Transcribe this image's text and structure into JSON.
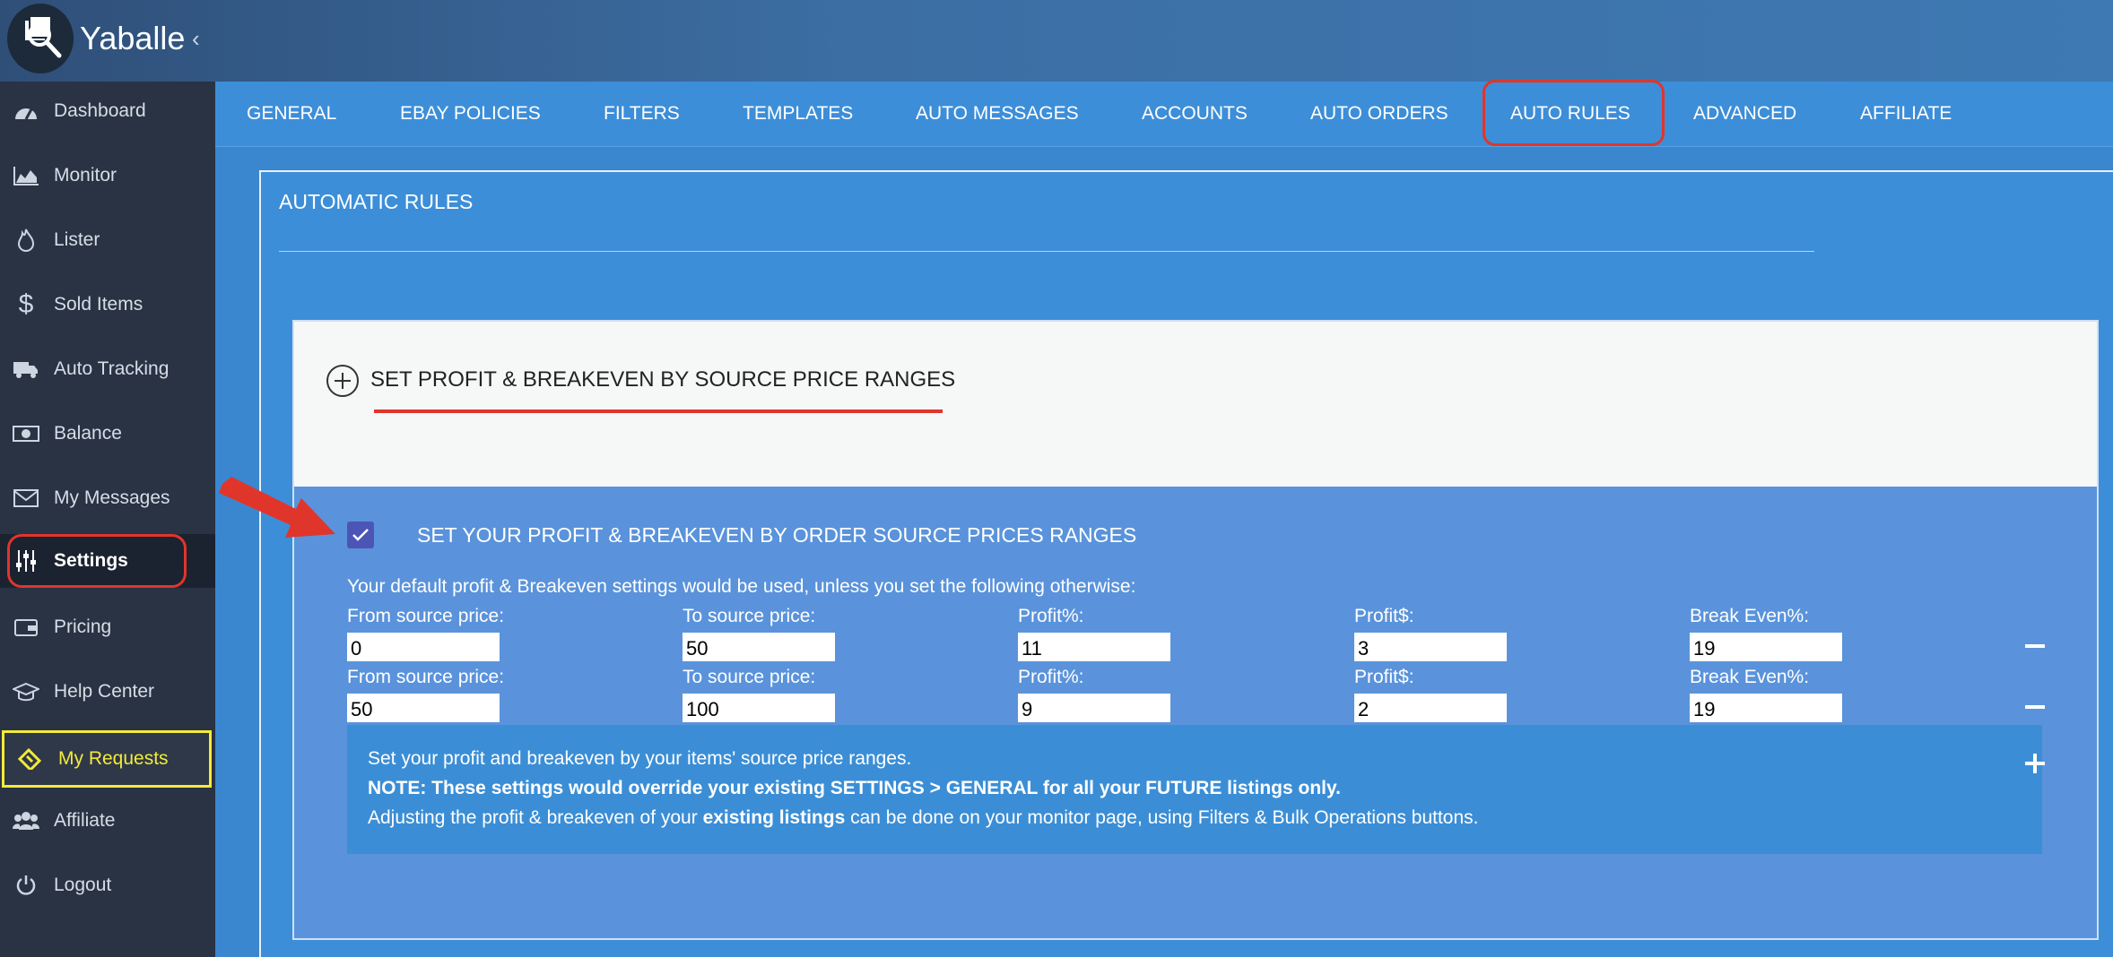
{
  "app": {
    "brand": "Yaballe",
    "collapse_icon": "chevron-left-icon"
  },
  "sidebar": {
    "items": [
      {
        "label": "Dashboard",
        "icon": "dashboard-gauge-icon"
      },
      {
        "label": "Monitor",
        "icon": "area-chart-icon"
      },
      {
        "label": "Lister",
        "icon": "flame-icon"
      },
      {
        "label": "Sold Items",
        "icon": "dollar-icon"
      },
      {
        "label": "Auto Tracking",
        "icon": "truck-icon"
      },
      {
        "label": "Balance",
        "icon": "banknote-icon"
      },
      {
        "label": "My Messages",
        "icon": "envelope-icon"
      },
      {
        "label": "Settings",
        "icon": "sliders-icon"
      },
      {
        "label": "Pricing",
        "icon": "wallet-icon"
      },
      {
        "label": "Help Center",
        "icon": "graduation-cap-icon"
      },
      {
        "label": "My Requests",
        "icon": "ticket-icon"
      },
      {
        "label": "Affiliate",
        "icon": "users-icon"
      },
      {
        "label": "Logout",
        "icon": "power-icon"
      }
    ],
    "active": "Settings"
  },
  "tabs": [
    "GENERAL",
    "EBAY POLICIES",
    "FILTERS",
    "TEMPLATES",
    "AUTO MESSAGES",
    "ACCOUNTS",
    "AUTO ORDERS",
    "AUTO RULES",
    "ADVANCED",
    "AFFILIATE"
  ],
  "active_tab": "AUTO RULES",
  "main": {
    "title": "AUTOMATIC RULES",
    "section_title": "SET PROFIT & BREAKEVEN BY SOURCE PRICE RANGES",
    "checkbox_label": "SET YOUR PROFIT & BREAKEVEN BY ORDER SOURCE PRICES RANGES",
    "checkbox_checked": true,
    "intro": "Your default profit & Breakeven settings would be used, unless you set the following otherwise:",
    "field_labels": {
      "from": "From source price:",
      "to": "To source price:",
      "profit_pct": "Profit%:",
      "profit_usd": "Profit$:",
      "break_even": "Break Even%:"
    },
    "rows": [
      {
        "from": "0",
        "to": "50",
        "profit_pct": "11",
        "profit_usd": "3",
        "break_even": "19"
      },
      {
        "from": "50",
        "to": "100",
        "profit_pct": "9",
        "profit_usd": "2",
        "break_even": "19"
      }
    ],
    "info": {
      "line1": "Set your profit and breakeven by your items' source price ranges.",
      "line2": "NOTE: These settings would override your existing SETTINGS > GENERAL for all your FUTURE listings only.",
      "line3_pre": "Adjusting the profit & breakeven of your ",
      "line3_bold": "existing listings",
      "line3_post": " can be done on your monitor page, using Filters & Bulk Operations buttons."
    }
  },
  "annotations": {
    "highlight_color": "#e0352b",
    "requests_highlight_color": "#f3ea3a"
  }
}
